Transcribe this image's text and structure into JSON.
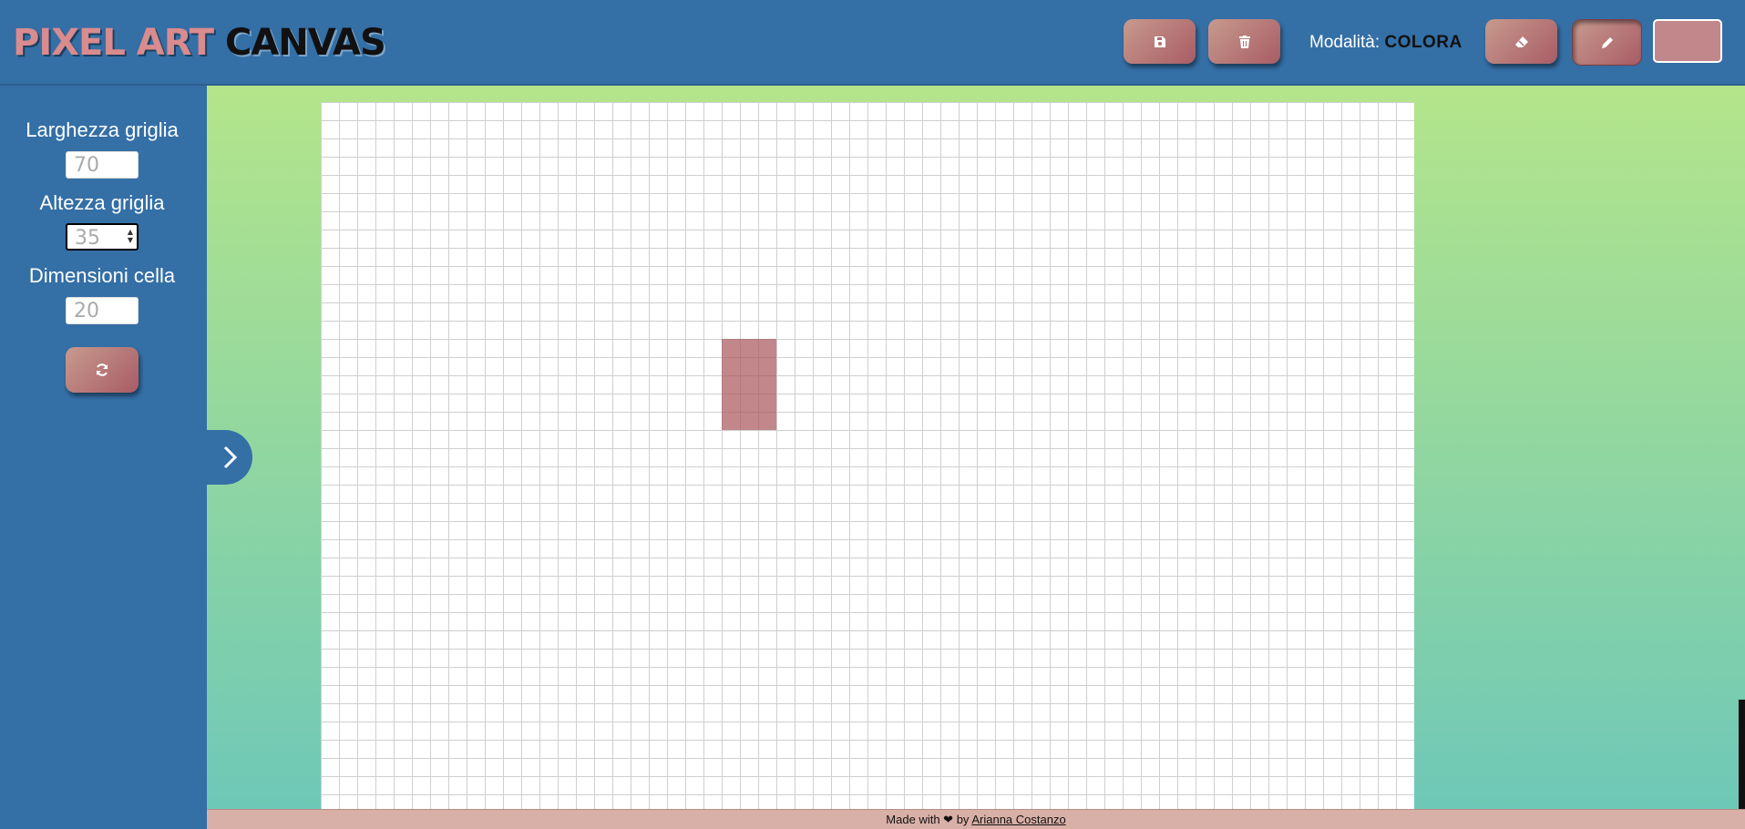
{
  "header": {
    "logo_part1": "PIXEL ART",
    "logo_part2": "CANVAS",
    "mode_label": "Modalità:",
    "mode_value": "COLORA",
    "current_color": "#c1878b"
  },
  "sidebar": {
    "width_label": "Larghezza griglia",
    "width_value": "70",
    "height_label": "Altezza griglia",
    "height_value": "35",
    "cell_label": "Dimensioni cella",
    "cell_value": "20"
  },
  "footer": {
    "text_before": "Made with",
    "heart": "❤",
    "text_by": "by",
    "author": "Arianna Costanzo"
  },
  "icons": {
    "save": "floppy-disk-icon",
    "delete": "trash-icon",
    "eraser": "eraser-icon",
    "pencil": "pencil-icon",
    "refresh": "refresh-icon",
    "toggle": "chevron-right-icon"
  },
  "colors": {
    "accent": "#346fa6",
    "button_gradient_start": "#c79a8d",
    "button_gradient_end": "#a95c66",
    "paint": "#c1878b"
  }
}
